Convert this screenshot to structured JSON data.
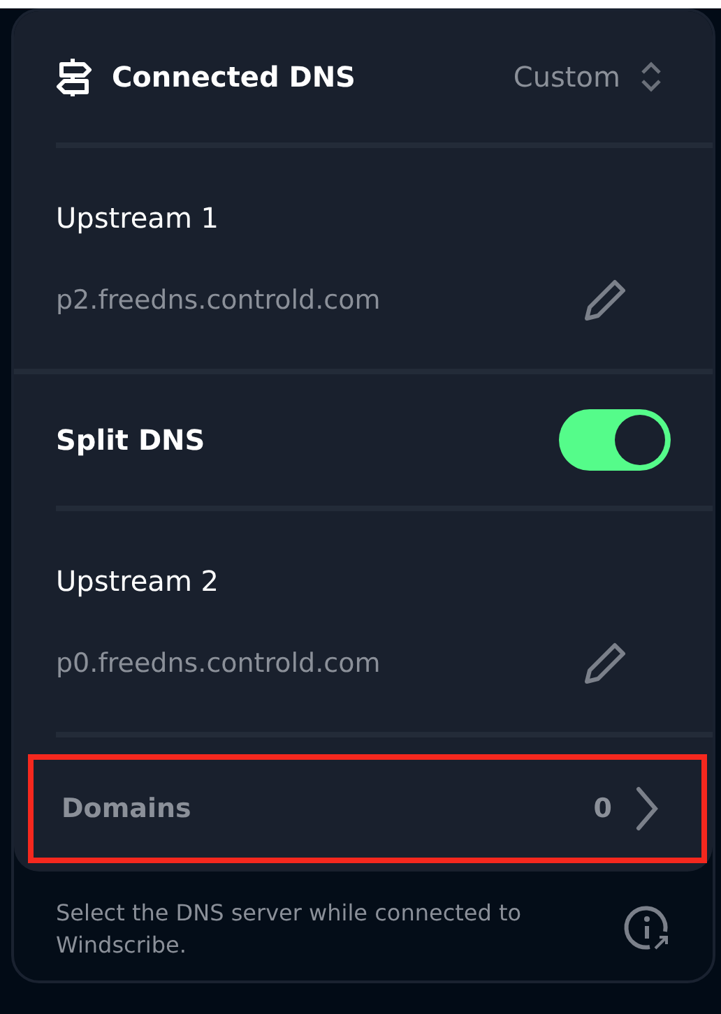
{
  "header": {
    "title": "Connected DNS",
    "mode": "Custom"
  },
  "upstream_1": {
    "label": "Upstream 1",
    "value": "p2.freedns.controld.com"
  },
  "split_dns": {
    "label": "Split DNS",
    "on": true
  },
  "upstream_2": {
    "label": "Upstream 2",
    "value": "p0.freedns.controld.com"
  },
  "domains": {
    "label": "Domains",
    "count": "0",
    "highlighted": true
  },
  "footer": {
    "text": "Select the DNS server while connected to Windscribe."
  }
}
